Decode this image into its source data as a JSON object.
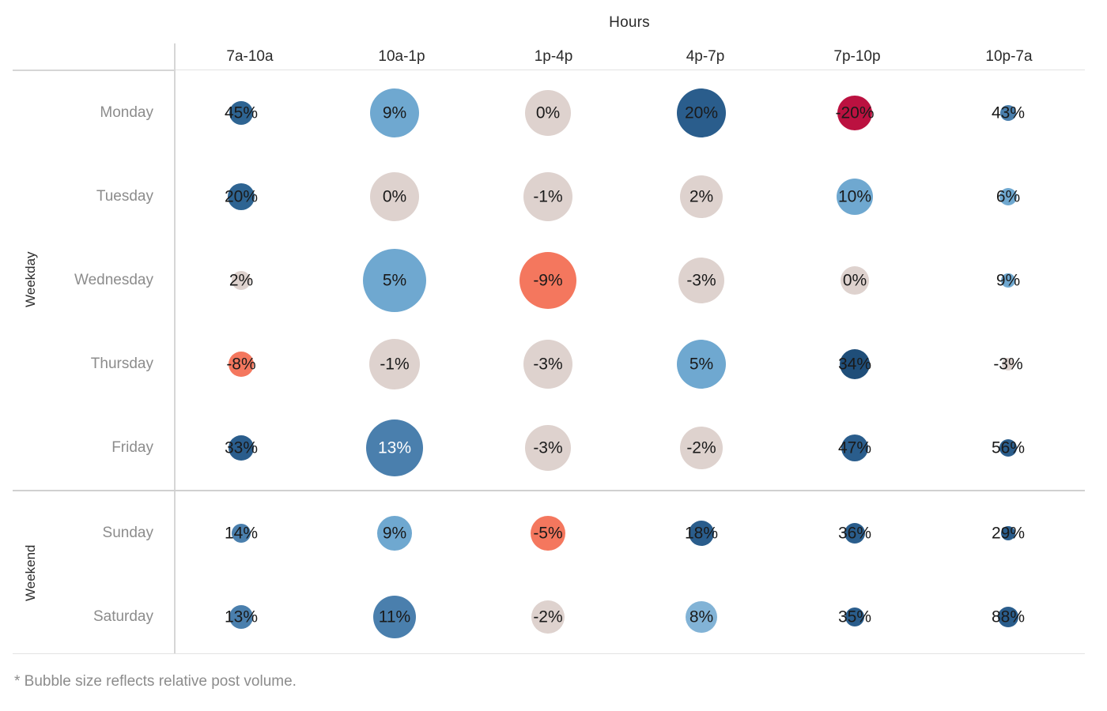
{
  "axis": {
    "columns_title": "Hours",
    "rows_title_weekday": "Weekday",
    "rows_title_weekend": "Weekend"
  },
  "footnote": "* Bubble size reflects relative post volume.",
  "colors": {
    "dark_blue": "#1f4e79",
    "mid_blue": "#2e6492",
    "steel_blue": "#4a7fad",
    "light_blue": "#82b3d6",
    "neutral": "#ded2ce",
    "salmon": "#f4775e",
    "red": "#e03a3a",
    "crimson": "#bb1140",
    "label_dark": "#1a1a1a",
    "label_light": "#ffffff",
    "row_label": "#8c8c8c",
    "gridline": "#d6d6d6"
  },
  "chart_data": {
    "type": "heatmap",
    "title": "",
    "xlabel": "Hours",
    "ylabel": "Weekday / Weekend",
    "categories": [
      "7a-10a",
      "10a-1p",
      "1p-4p",
      "4p-7p",
      "7p-10p",
      "10p-7a"
    ],
    "groups": [
      {
        "name": "Weekday",
        "rows": [
          {
            "label": "Monday",
            "cells": [
              {
                "label": "45%",
                "value": 45,
                "size": 30,
                "color": "#2e6492",
                "text_color": "#1a1a1a"
              },
              {
                "label": "9%",
                "value": 9,
                "size": 62,
                "color": "#6fa8d0",
                "text_color": "#1a1a1a"
              },
              {
                "label": "0%",
                "value": 0,
                "size": 58,
                "color": "#ded2ce",
                "text_color": "#1a1a1a"
              },
              {
                "label": "20%",
                "value": 20,
                "size": 62,
                "color": "#2a5d8c",
                "text_color": "#1a1a1a"
              },
              {
                "label": "-20%",
                "value": -20,
                "size": 44,
                "color": "#bb1140",
                "text_color": "#1a1a1a"
              },
              {
                "label": "43%",
                "value": 43,
                "size": 20,
                "color": "#4a7fad",
                "text_color": "#1a1a1a"
              }
            ]
          },
          {
            "label": "Tuesday",
            "cells": [
              {
                "label": "20%",
                "value": 20,
                "size": 34,
                "color": "#2e6492",
                "text_color": "#1a1a1a"
              },
              {
                "label": "0%",
                "value": 0,
                "size": 62,
                "color": "#ded2ce",
                "text_color": "#1a1a1a"
              },
              {
                "label": "-1%",
                "value": -1,
                "size": 62,
                "color": "#ded2ce",
                "text_color": "#1a1a1a"
              },
              {
                "label": "2%",
                "value": 2,
                "size": 54,
                "color": "#ded2ce",
                "text_color": "#1a1a1a"
              },
              {
                "label": "10%",
                "value": 10,
                "size": 46,
                "color": "#6fa8d0",
                "text_color": "#1a1a1a"
              },
              {
                "label": "6%",
                "value": 6,
                "size": 22,
                "color": "#6fa8d0",
                "text_color": "#1a1a1a"
              }
            ]
          },
          {
            "label": "Wednesday",
            "cells": [
              {
                "label": "2%",
                "value": 2,
                "size": 24,
                "color": "#ded2ce",
                "text_color": "#1a1a1a"
              },
              {
                "label": "5%",
                "value": 5,
                "size": 80,
                "color": "#6fa8d0",
                "text_color": "#1a1a1a"
              },
              {
                "label": "-9%",
                "value": -9,
                "size": 72,
                "color": "#f4775e",
                "text_color": "#1a1a1a"
              },
              {
                "label": "-3%",
                "value": -3,
                "size": 58,
                "color": "#ded2ce",
                "text_color": "#1a1a1a"
              },
              {
                "label": "0%",
                "value": 0,
                "size": 36,
                "color": "#ded2ce",
                "text_color": "#1a1a1a"
              },
              {
                "label": "9%",
                "value": 9,
                "size": 18,
                "color": "#6fa8d0",
                "text_color": "#1a1a1a"
              }
            ]
          },
          {
            "label": "Thursday",
            "cells": [
              {
                "label": "-8%",
                "value": -8,
                "size": 32,
                "color": "#f4775e",
                "text_color": "#1a1a1a"
              },
              {
                "label": "-1%",
                "value": -1,
                "size": 64,
                "color": "#ded2ce",
                "text_color": "#1a1a1a"
              },
              {
                "label": "-3%",
                "value": -3,
                "size": 62,
                "color": "#ded2ce",
                "text_color": "#1a1a1a"
              },
              {
                "label": "5%",
                "value": 5,
                "size": 62,
                "color": "#6fa8d0",
                "text_color": "#1a1a1a"
              },
              {
                "label": "34%",
                "value": 34,
                "size": 38,
                "color": "#1f4e79",
                "text_color": "#1a1a1a"
              },
              {
                "label": "-3%",
                "value": -3,
                "size": 16,
                "color": "#ded2ce",
                "text_color": "#1a1a1a"
              }
            ]
          },
          {
            "label": "Friday",
            "cells": [
              {
                "label": "33%",
                "value": 33,
                "size": 32,
                "color": "#2a5d8c",
                "text_color": "#1a1a1a"
              },
              {
                "label": "13%",
                "value": 13,
                "size": 72,
                "color": "#4a7fad",
                "text_color": "#ffffff"
              },
              {
                "label": "-3%",
                "value": -3,
                "size": 58,
                "color": "#ded2ce",
                "text_color": "#1a1a1a"
              },
              {
                "label": "-2%",
                "value": -2,
                "size": 54,
                "color": "#ded2ce",
                "text_color": "#1a1a1a"
              },
              {
                "label": "47%",
                "value": 47,
                "size": 34,
                "color": "#2a5d8c",
                "text_color": "#1a1a1a"
              },
              {
                "label": "56%",
                "value": 56,
                "size": 22,
                "color": "#2a5d8c",
                "text_color": "#1a1a1a"
              }
            ]
          }
        ]
      },
      {
        "name": "Weekend",
        "rows": [
          {
            "label": "Sunday",
            "cells": [
              {
                "label": "14%",
                "value": 14,
                "size": 24,
                "color": "#4a7fad",
                "text_color": "#1a1a1a"
              },
              {
                "label": "9%",
                "value": 9,
                "size": 44,
                "color": "#6fa8d0",
                "text_color": "#1a1a1a"
              },
              {
                "label": "-5%",
                "value": -5,
                "size": 44,
                "color": "#f4775e",
                "text_color": "#1a1a1a"
              },
              {
                "label": "18%",
                "value": 18,
                "size": 32,
                "color": "#2a5d8c",
                "text_color": "#1a1a1a"
              },
              {
                "label": "36%",
                "value": 36,
                "size": 26,
                "color": "#2a5d8c",
                "text_color": "#1a1a1a"
              },
              {
                "label": "29%",
                "value": 29,
                "size": 18,
                "color": "#2a5d8c",
                "text_color": "#1a1a1a"
              }
            ]
          },
          {
            "label": "Saturday",
            "cells": [
              {
                "label": "13%",
                "value": 13,
                "size": 30,
                "color": "#4a7fad",
                "text_color": "#1a1a1a"
              },
              {
                "label": "11%",
                "value": 11,
                "size": 54,
                "color": "#4a7fad",
                "text_color": "#1a1a1a"
              },
              {
                "label": "-2%",
                "value": -2,
                "size": 42,
                "color": "#ded2ce",
                "text_color": "#1a1a1a"
              },
              {
                "label": "8%",
                "value": 8,
                "size": 40,
                "color": "#82b3d6",
                "text_color": "#1a1a1a"
              },
              {
                "label": "35%",
                "value": 35,
                "size": 24,
                "color": "#2a5d8c",
                "text_color": "#1a1a1a"
              },
              {
                "label": "88%",
                "value": 88,
                "size": 26,
                "color": "#2a5d8c",
                "text_color": "#1a1a1a"
              }
            ]
          }
        ]
      }
    ]
  }
}
